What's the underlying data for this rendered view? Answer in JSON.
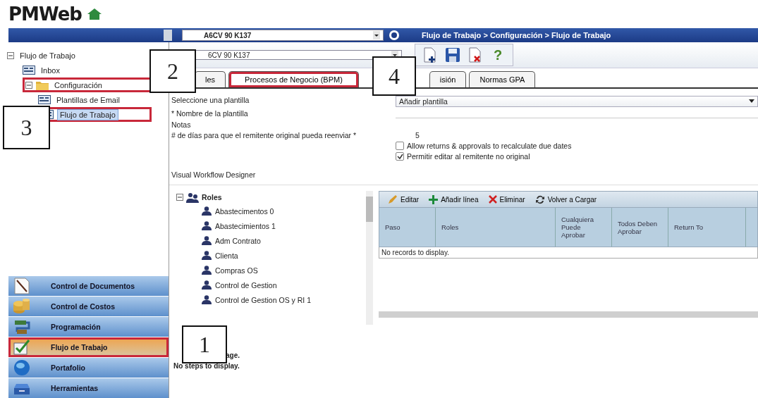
{
  "logo": {
    "text": "PMWeb"
  },
  "top_bar": {
    "project": "A6CV 90 K137",
    "breadcrumb": "Flujo de Trabajo > Configuración > Flujo de Trabajo"
  },
  "sidebar": {
    "tree": [
      {
        "label": "Flujo de Trabajo",
        "kind": "root",
        "expanded": true,
        "selected": false,
        "highlighted": false,
        "children": [
          {
            "label": "Inbox",
            "kind": "form",
            "selected": false,
            "highlighted": false
          },
          {
            "label": "Configuración",
            "kind": "folder",
            "expanded": true,
            "selected": false,
            "highlighted": true,
            "children": [
              {
                "label": "Plantillas de Email",
                "kind": "form",
                "selected": false,
                "highlighted": false
              },
              {
                "label": "Flujo de Trabajo",
                "kind": "form",
                "selected": true,
                "highlighted": true
              }
            ]
          }
        ]
      }
    ],
    "nav": [
      {
        "label": "Control de Documentos",
        "kind": "documents",
        "selected": false,
        "highlighted": false
      },
      {
        "label": "Control de Costos",
        "kind": "costs",
        "selected": false,
        "highlighted": false
      },
      {
        "label": "Programación",
        "kind": "schedule",
        "selected": false,
        "highlighted": false
      },
      {
        "label": "Flujo de Trabajo",
        "kind": "workflow",
        "selected": true,
        "highlighted": true
      },
      {
        "label": "Portafolio",
        "kind": "portfolio",
        "selected": false,
        "highlighted": false
      },
      {
        "label": "Herramientas",
        "kind": "tools",
        "selected": false,
        "highlighted": false
      }
    ]
  },
  "record": {
    "project": "6CV 90 K137",
    "toolbar": [
      {
        "kind": "new"
      },
      {
        "kind": "save"
      },
      {
        "kind": "delete"
      },
      {
        "kind": "help",
        "glyph": "?"
      }
    ]
  },
  "tabs": [
    {
      "label": "les",
      "selected": false,
      "highlighted": false
    },
    {
      "label": "Procesos de Negocio (BPM)",
      "selected": true,
      "highlighted": true
    },
    {
      "label": "isión",
      "selected": false,
      "highlighted": false
    },
    {
      "label": "Normas GPA",
      "selected": false,
      "highlighted": false
    }
  ],
  "form": {
    "template_label": "Seleccione una plantilla",
    "template_value": "Añadir plantilla",
    "name_label": "* Nombre de la plantilla",
    "notes_label": "Notas",
    "days_label": "# de días para que el remitente original pueda reenviar *",
    "days_value": "5",
    "checkboxes": [
      {
        "label": "Allow returns & approvals to recalculate due dates",
        "checked": false
      },
      {
        "label": "Permitir editar al remitente no original",
        "checked": true
      }
    ]
  },
  "designer": {
    "title": "Visual Workflow Designer",
    "roles_root": "Roles",
    "roles": [
      "Abastecimentos 0",
      "Abastecimientos 1",
      "Adm Contrato",
      "Clienta",
      "Compras OS",
      "Control de Gestion",
      "Control de Gestion OS y RI 1"
    ],
    "grid_toolbar": [
      {
        "label": "Editar",
        "kind": "edit"
      },
      {
        "label": "Añadir línea",
        "kind": "add"
      },
      {
        "label": "Eliminar",
        "kind": "delete"
      },
      {
        "label": "Volver a Cargar",
        "kind": "reload"
      }
    ],
    "columns": [
      "Paso",
      "Roles",
      "Cualquiera Puede Aprobar",
      "Todos Deben Aprobar",
      "Return To"
    ],
    "empty_message": "No records to display."
  },
  "footer": {
    "message": "age.",
    "steps": "No steps to display."
  },
  "callouts": [
    {
      "label": "2"
    },
    {
      "label": "4"
    },
    {
      "label": "3"
    },
    {
      "label": "1"
    }
  ]
}
